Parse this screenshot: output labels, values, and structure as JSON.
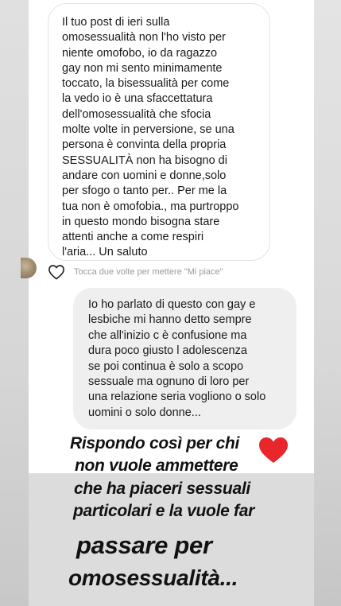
{
  "conversation": {
    "received_message": "Il tuo post di ieri sulla\nomosessualità non l'ho visto per\nniente omofobo, io da ragazzo\ngay non mi sento minimamente\ntoccato, la bisessualità per come\nla vedo io è una sfaccettatura\ndell'omosessualità che sfocia\nmolte volte in perversione, se una\npersona è convinta della propria\nSESSUALITÀ non ha bisogno di\nandare con uomini e donne,solo\nper sfogo o tanto per.. Per me la\ntua non è omofobia., ma purtroppo\nin questo mondo bisogna stare\nattenti anche a come respiri\nl'aria... Un saluto",
    "like_hint": "Tocca due volte per mettere \"Mi piace\"",
    "sent_message": "Io ho parlato di questo con gay e\nlesbiche mi hanno detto sempre\nche all'inizio c è confusione ma\ndura poco giusto l adolescenza\nse poi continua è solo a scopo\nsessuale ma ognuno di loro per\nuna relazione seria vogliono o solo\nuomini o solo donne..."
  },
  "story_caption": {
    "line1": "Rispondo così per  chi",
    "line2": "non vuole ammettere",
    "line3": "che ha piaceri sessuali",
    "line4": "particolari e la vuole far",
    "line5": "passare  per",
    "line6": "omosessualità..."
  },
  "icons": {
    "like": "heart-outline-icon",
    "sticker": "heart-red-icon"
  },
  "colors": {
    "received_bubble": "#ffffff",
    "sent_bubble": "#efefef",
    "heart_sticker": "#e8262b",
    "background": "#dcdcdc"
  }
}
